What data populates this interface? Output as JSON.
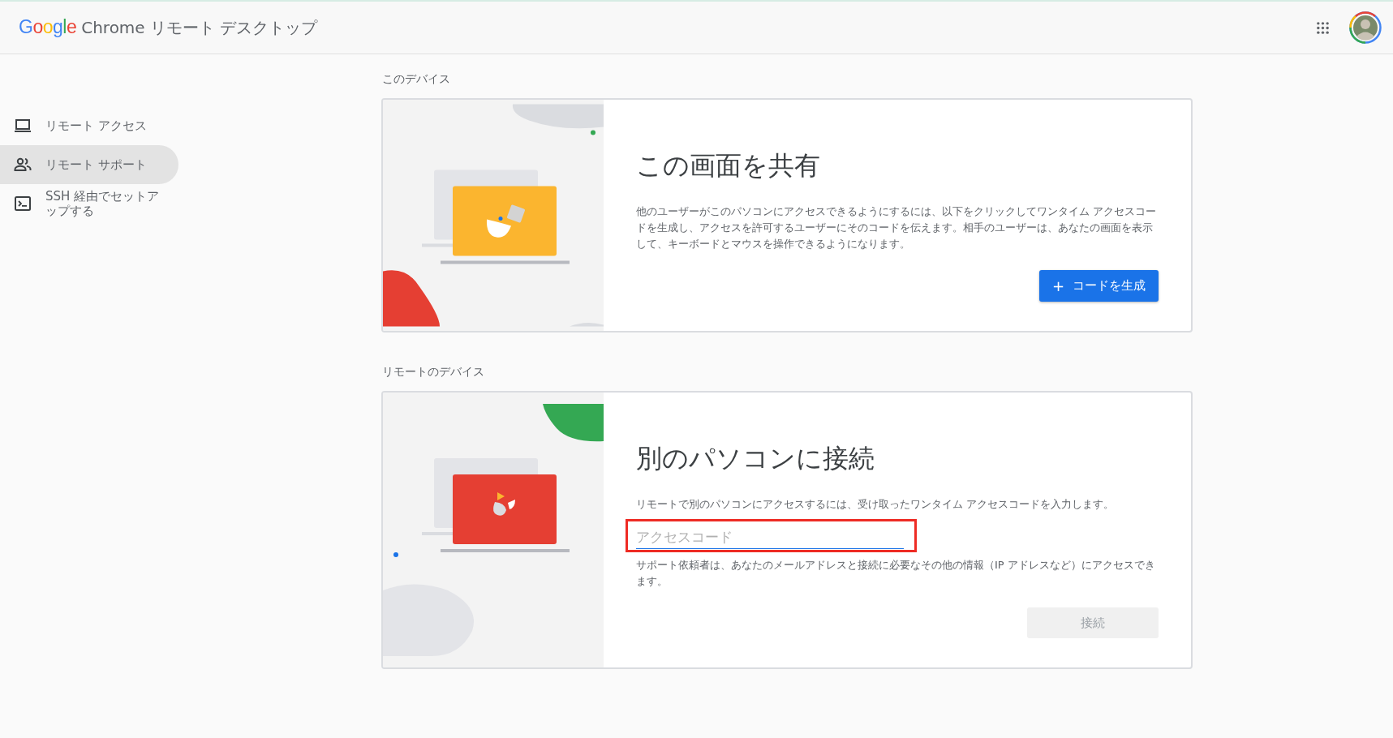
{
  "header": {
    "logo": "Google",
    "title": "Chrome リモート デスクトップ"
  },
  "sidebar": {
    "items": [
      {
        "label": "リモート アクセス",
        "kind": "laptop",
        "selected": false
      },
      {
        "label": "リモート サポート",
        "kind": "people",
        "selected": true
      },
      {
        "label": "SSH 経由でセットアップする",
        "kind": "terminal",
        "selected": false
      }
    ]
  },
  "sections": [
    {
      "heading": "このデバイス",
      "kind": "share",
      "title": "この画面を共有",
      "description": "他のユーザーがこのパソコンにアクセスできるようにするには、以下をクリックしてワンタイム アクセスコードを生成し、アクセスを許可するユーザーにそのコードを伝えます。相手のユーザーは、あなたの画面を表示して、キーボードとマウスを操作できるようになります。",
      "button": {
        "label": "コードを生成",
        "icon": "+",
        "disabled": false
      }
    },
    {
      "heading": "リモートのデバイス",
      "kind": "connect",
      "title": "別のパソコンに接続",
      "description": "リモートで別のパソコンにアクセスするには、受け取ったワンタイム アクセスコードを入力します。",
      "field": {
        "placeholder": "アクセスコード",
        "highlighted": true
      },
      "note": "サポート依頼者は、あなたのメールアドレスと接続に必要なその他の情報（IP アドレスなど）にアクセスできます。",
      "button": {
        "label": "接続",
        "disabled": true
      }
    }
  ]
}
